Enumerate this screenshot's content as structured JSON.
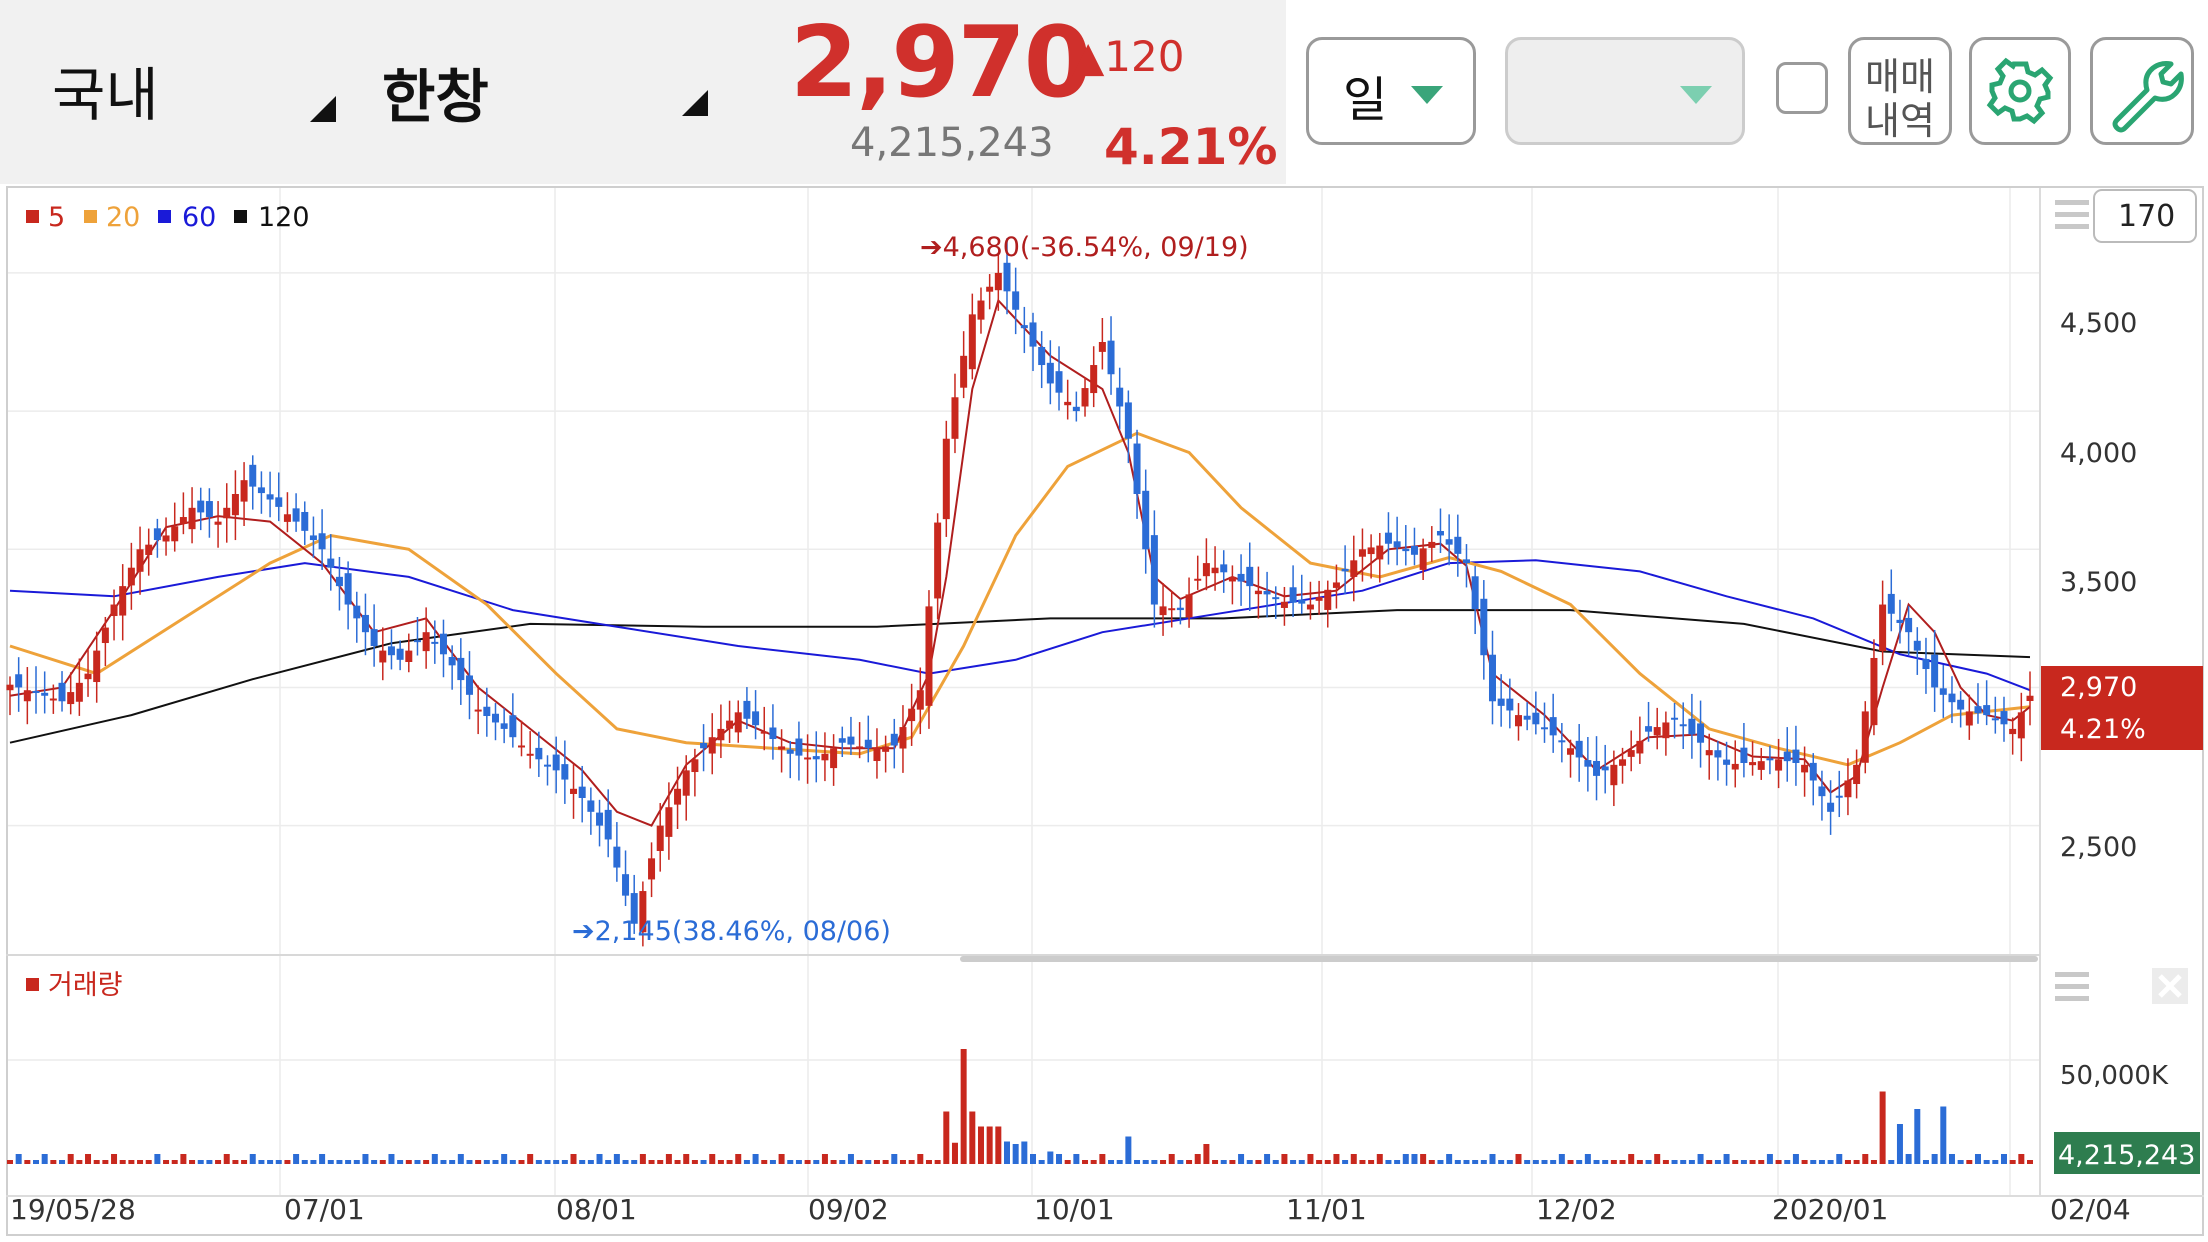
{
  "header": {
    "market": "국내",
    "stock": "한창",
    "price": "2,970",
    "change": "▲120",
    "volume": "4,215,243",
    "change_pct": "4.21%",
    "period_label": "일",
    "trade_label_1": "매매",
    "trade_label_2": "내역"
  },
  "colors": {
    "up": "#c8281e",
    "down": "#2b6cd6",
    "ma5": "#b01e1e",
    "ma20": "#eea23a",
    "ma60": "#1a1ad8",
    "ma120": "#111111",
    "accent": "#3aa57a"
  },
  "icons": [
    "dropdown-caret-icon",
    "gear-icon",
    "wrench-icon",
    "menu-lines-icon",
    "close-icon"
  ],
  "chart_data": {
    "type": "candlestick",
    "price_axis": {
      "ticks": [
        2500,
        3000,
        3500,
        4000,
        4500
      ],
      "tick_labels": [
        "2,500",
        "",
        "3,500",
        "4,000",
        "4,500"
      ],
      "ylim": [
        2050,
        4800
      ]
    },
    "volume_axis": {
      "ticks": [
        50000000
      ],
      "tick_labels": [
        "50,000K"
      ]
    },
    "x_labels": [
      "19/05/28",
      "07/01",
      "08/01",
      "09/02",
      "10/01",
      "11/01",
      "12/02",
      "2020/01",
      "02/04"
    ],
    "legend": [
      {
        "name": "5"
      },
      {
        "name": "20"
      },
      {
        "name": "60"
      },
      {
        "name": "120"
      }
    ],
    "zoom_value": "170",
    "volume_panel_title": "거래량",
    "current_price_label": "2,970",
    "current_pct_label": "4.21%",
    "current_volume_label": "4,215,243",
    "annotations": [
      {
        "text": "➔4,680(-36.54%, 09/19)",
        "value": 4680
      },
      {
        "text": "➔2,145(38.46%, 08/06)",
        "value": 2145
      }
    ],
    "series": [
      {
        "name": "price",
        "points": [
          [
            0,
            3010
          ],
          [
            3,
            2980
          ],
          [
            6,
            2950
          ],
          [
            9,
            3050
          ],
          [
            12,
            3300
          ],
          [
            15,
            3500
          ],
          [
            18,
            3550
          ],
          [
            21,
            3650
          ],
          [
            24,
            3600
          ],
          [
            27,
            3750
          ],
          [
            30,
            3680
          ],
          [
            33,
            3600
          ],
          [
            36,
            3500
          ],
          [
            39,
            3300
          ],
          [
            42,
            3150
          ],
          [
            45,
            3100
          ],
          [
            48,
            3200
          ],
          [
            51,
            3080
          ],
          [
            54,
            2920
          ],
          [
            57,
            2850
          ],
          [
            60,
            2760
          ],
          [
            63,
            2700
          ],
          [
            66,
            2600
          ],
          [
            69,
            2450
          ],
          [
            72,
            2145
          ],
          [
            75,
            2500
          ],
          [
            78,
            2700
          ],
          [
            81,
            2820
          ],
          [
            84,
            2910
          ],
          [
            87,
            2840
          ],
          [
            90,
            2760
          ],
          [
            93,
            2740
          ],
          [
            96,
            2800
          ],
          [
            99,
            2780
          ],
          [
            102,
            2790
          ],
          [
            105,
            2990
          ],
          [
            108,
            3900
          ],
          [
            111,
            4350
          ],
          [
            114,
            4500
          ],
          [
            117,
            4300
          ],
          [
            120,
            4100
          ],
          [
            123,
            4000
          ],
          [
            126,
            4250
          ],
          [
            129,
            3900
          ],
          [
            132,
            3300
          ],
          [
            135,
            3280
          ],
          [
            138,
            3450
          ],
          [
            141,
            3400
          ],
          [
            144,
            3350
          ],
          [
            147,
            3310
          ],
          [
            150,
            3300
          ],
          [
            153,
            3380
          ],
          [
            156,
            3500
          ],
          [
            159,
            3520
          ],
          [
            162,
            3480
          ],
          [
            165,
            3550
          ],
          [
            168,
            3450
          ],
          [
            171,
            2950
          ],
          [
            174,
            2900
          ],
          [
            177,
            2850
          ],
          [
            180,
            2780
          ],
          [
            183,
            2680
          ],
          [
            186,
            2740
          ],
          [
            189,
            2840
          ],
          [
            192,
            2890
          ],
          [
            195,
            2800
          ],
          [
            198,
            2720
          ],
          [
            201,
            2730
          ],
          [
            204,
            2740
          ],
          [
            207,
            2720
          ],
          [
            210,
            2550
          ],
          [
            213,
            2720
          ],
          [
            216,
            3300
          ],
          [
            219,
            3200
          ],
          [
            222,
            3000
          ],
          [
            225,
            2920
          ],
          [
            228,
            2900
          ],
          [
            231,
            2850
          ],
          [
            233,
            2970
          ]
        ]
      },
      {
        "name": "5",
        "points": [
          [
            0,
            2970
          ],
          [
            6,
            3000
          ],
          [
            12,
            3280
          ],
          [
            18,
            3580
          ],
          [
            24,
            3620
          ],
          [
            30,
            3600
          ],
          [
            36,
            3450
          ],
          [
            42,
            3200
          ],
          [
            48,
            3250
          ],
          [
            54,
            3000
          ],
          [
            60,
            2850
          ],
          [
            66,
            2700
          ],
          [
            70,
            2550
          ],
          [
            74,
            2500
          ],
          [
            78,
            2720
          ],
          [
            84,
            2880
          ],
          [
            90,
            2800
          ],
          [
            96,
            2780
          ],
          [
            102,
            2780
          ],
          [
            106,
            3050
          ],
          [
            108,
            3400
          ],
          [
            111,
            4080
          ],
          [
            114,
            4400
          ],
          [
            120,
            4200
          ],
          [
            126,
            4080
          ],
          [
            129,
            3850
          ],
          [
            132,
            3400
          ],
          [
            135,
            3320
          ],
          [
            141,
            3400
          ],
          [
            147,
            3330
          ],
          [
            153,
            3350
          ],
          [
            159,
            3500
          ],
          [
            165,
            3520
          ],
          [
            168,
            3440
          ],
          [
            171,
            3050
          ],
          [
            177,
            2900
          ],
          [
            183,
            2700
          ],
          [
            189,
            2820
          ],
          [
            195,
            2830
          ],
          [
            201,
            2750
          ],
          [
            207,
            2740
          ],
          [
            210,
            2620
          ],
          [
            213,
            2680
          ],
          [
            216,
            3000
          ],
          [
            219,
            3300
          ],
          [
            222,
            3200
          ],
          [
            225,
            3000
          ],
          [
            228,
            2900
          ],
          [
            231,
            2880
          ],
          [
            233,
            2930
          ]
        ]
      },
      {
        "name": "20",
        "points": [
          [
            0,
            3150
          ],
          [
            10,
            3050
          ],
          [
            20,
            3250
          ],
          [
            30,
            3450
          ],
          [
            37,
            3550
          ],
          [
            46,
            3500
          ],
          [
            55,
            3300
          ],
          [
            63,
            3050
          ],
          [
            70,
            2850
          ],
          [
            78,
            2800
          ],
          [
            88,
            2780
          ],
          [
            98,
            2760
          ],
          [
            104,
            2820
          ],
          [
            110,
            3150
          ],
          [
            116,
            3550
          ],
          [
            122,
            3800
          ],
          [
            130,
            3920
          ],
          [
            136,
            3850
          ],
          [
            142,
            3650
          ],
          [
            150,
            3450
          ],
          [
            158,
            3400
          ],
          [
            166,
            3470
          ],
          [
            172,
            3420
          ],
          [
            180,
            3300
          ],
          [
            188,
            3050
          ],
          [
            196,
            2850
          ],
          [
            204,
            2780
          ],
          [
            212,
            2720
          ],
          [
            218,
            2800
          ],
          [
            224,
            2900
          ],
          [
            230,
            2920
          ],
          [
            233,
            2930
          ]
        ]
      },
      {
        "name": "60",
        "points": [
          [
            0,
            3350
          ],
          [
            12,
            3330
          ],
          [
            24,
            3400
          ],
          [
            34,
            3450
          ],
          [
            46,
            3400
          ],
          [
            58,
            3280
          ],
          [
            70,
            3220
          ],
          [
            84,
            3150
          ],
          [
            98,
            3100
          ],
          [
            106,
            3050
          ],
          [
            116,
            3100
          ],
          [
            126,
            3200
          ],
          [
            140,
            3270
          ],
          [
            156,
            3350
          ],
          [
            166,
            3450
          ],
          [
            176,
            3460
          ],
          [
            188,
            3420
          ],
          [
            198,
            3330
          ],
          [
            208,
            3250
          ],
          [
            218,
            3120
          ],
          [
            228,
            3050
          ],
          [
            233,
            2990
          ]
        ]
      },
      {
        "name": "120",
        "points": [
          [
            0,
            2800
          ],
          [
            14,
            2900
          ],
          [
            28,
            3030
          ],
          [
            44,
            3160
          ],
          [
            60,
            3230
          ],
          [
            80,
            3220
          ],
          [
            100,
            3220
          ],
          [
            120,
            3250
          ],
          [
            140,
            3250
          ],
          [
            160,
            3280
          ],
          [
            180,
            3280
          ],
          [
            200,
            3230
          ],
          [
            216,
            3130
          ],
          [
            233,
            3110
          ]
        ]
      }
    ]
  }
}
